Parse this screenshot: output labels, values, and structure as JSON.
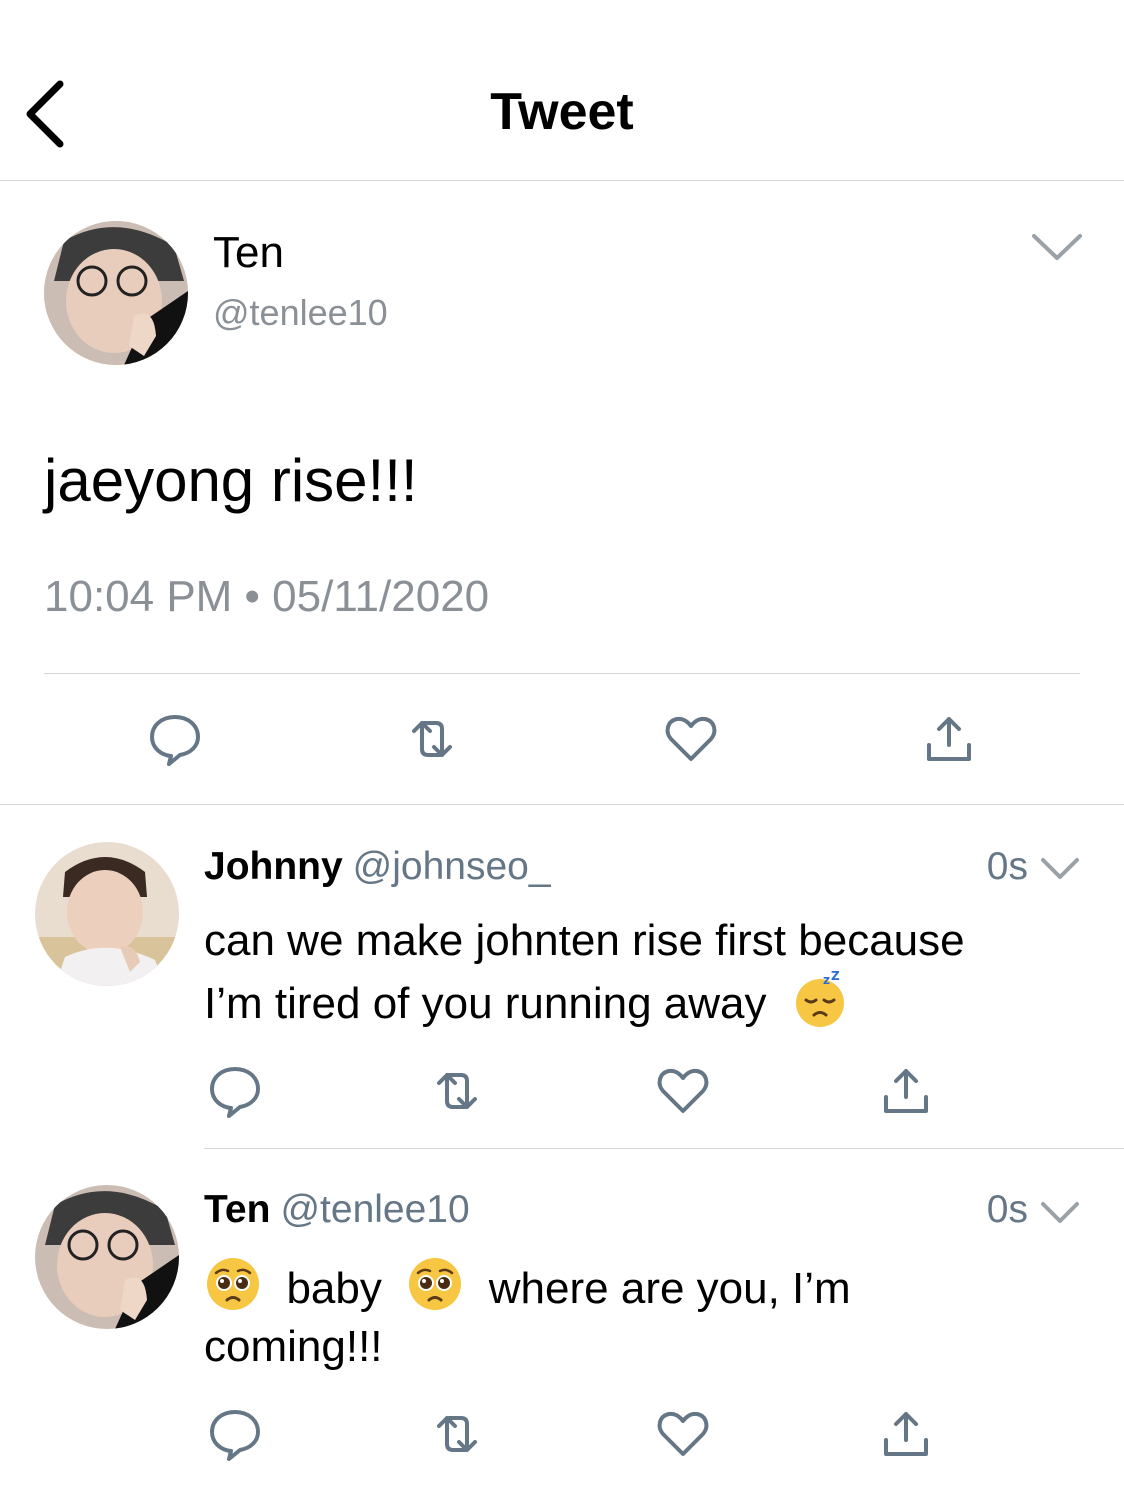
{
  "header": {
    "title": "Tweet"
  },
  "main_tweet": {
    "name": "Ten",
    "handle": "@tenlee10",
    "text": "jaeyong rise!!!",
    "timestamp": "10:04 PM • 05/11/2020"
  },
  "replies": [
    {
      "name": "Johnny",
      "handle": "@johnseo_",
      "time": "0s",
      "text_line1": "can we make johnten rise first because",
      "text_line2": "I’m tired of you running away",
      "emoji": "sleeping-face"
    },
    {
      "name": "Ten",
      "handle": "@tenlee10",
      "time": "0s",
      "text_part1": "baby",
      "text_part2": "where are you, I’m",
      "text_line2": "coming!!!",
      "emoji": "pleading-face"
    }
  ],
  "colors": {
    "icon_gray": "#657786",
    "timestamp_gray": "#8a9096",
    "divider": "#d3d6da"
  }
}
